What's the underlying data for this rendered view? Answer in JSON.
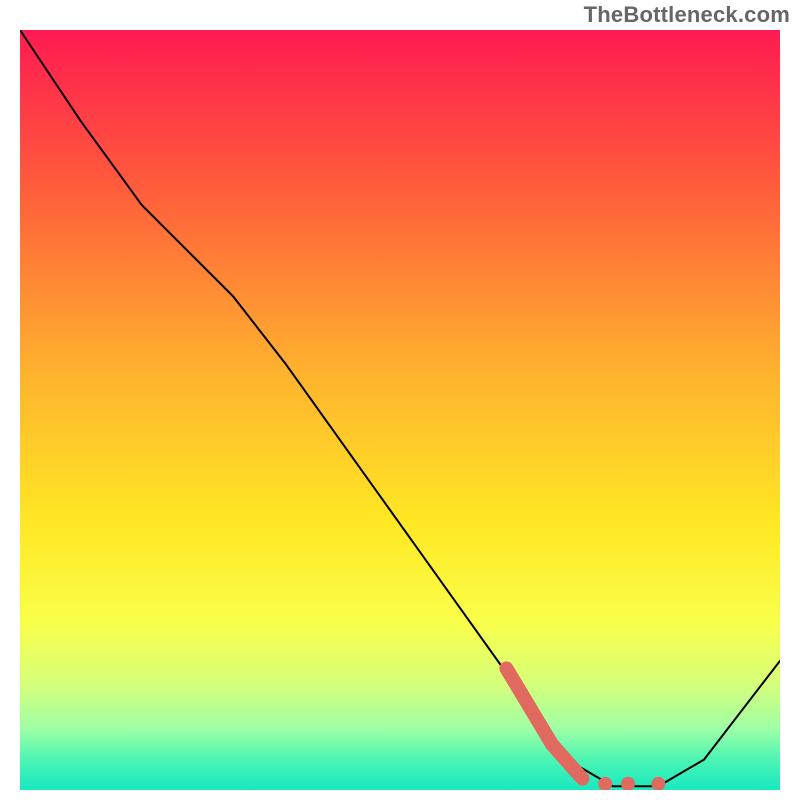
{
  "watermark": "TheBottleneck.com",
  "chart_data": {
    "type": "line",
    "title": "",
    "xlabel": "",
    "ylabel": "",
    "xlim": [
      0,
      100
    ],
    "ylim": [
      0,
      100
    ],
    "background_gradient_stops": [
      {
        "offset": 0,
        "color": "#ff1a52"
      },
      {
        "offset": 0.2,
        "color": "#ff5a3c"
      },
      {
        "offset": 0.45,
        "color": "#ffb22e"
      },
      {
        "offset": 0.65,
        "color": "#ffe824"
      },
      {
        "offset": 0.78,
        "color": "#f9ff4a"
      },
      {
        "offset": 0.86,
        "color": "#d6ff7a"
      },
      {
        "offset": 0.92,
        "color": "#9effa6"
      },
      {
        "offset": 0.96,
        "color": "#4cf5b3"
      },
      {
        "offset": 1.0,
        "color": "#18e8c0"
      }
    ],
    "series": [
      {
        "name": "curve",
        "color": "#000000",
        "stroke_width": 2,
        "points": [
          {
            "x": 0,
            "y": 100
          },
          {
            "x": 8,
            "y": 88
          },
          {
            "x": 16,
            "y": 77
          },
          {
            "x": 22,
            "y": 71
          },
          {
            "x": 28,
            "y": 65
          },
          {
            "x": 35,
            "y": 56
          },
          {
            "x": 45,
            "y": 42
          },
          {
            "x": 55,
            "y": 28
          },
          {
            "x": 65,
            "y": 14
          },
          {
            "x": 72,
            "y": 4
          },
          {
            "x": 78,
            "y": 0.5
          },
          {
            "x": 84,
            "y": 0.5
          },
          {
            "x": 90,
            "y": 4
          },
          {
            "x": 100,
            "y": 17
          }
        ]
      },
      {
        "name": "highlight-segment",
        "color": "#e06a5f",
        "stroke_width": 14,
        "points": [
          {
            "x": 64,
            "y": 16
          },
          {
            "x": 70,
            "y": 6
          },
          {
            "x": 74,
            "y": 1.5
          }
        ]
      }
    ],
    "highlight_dots": {
      "color": "#e06a5f",
      "radius": 7,
      "points": [
        {
          "x": 77,
          "y": 0.8
        },
        {
          "x": 80,
          "y": 0.8
        },
        {
          "x": 84,
          "y": 0.8
        }
      ]
    }
  }
}
